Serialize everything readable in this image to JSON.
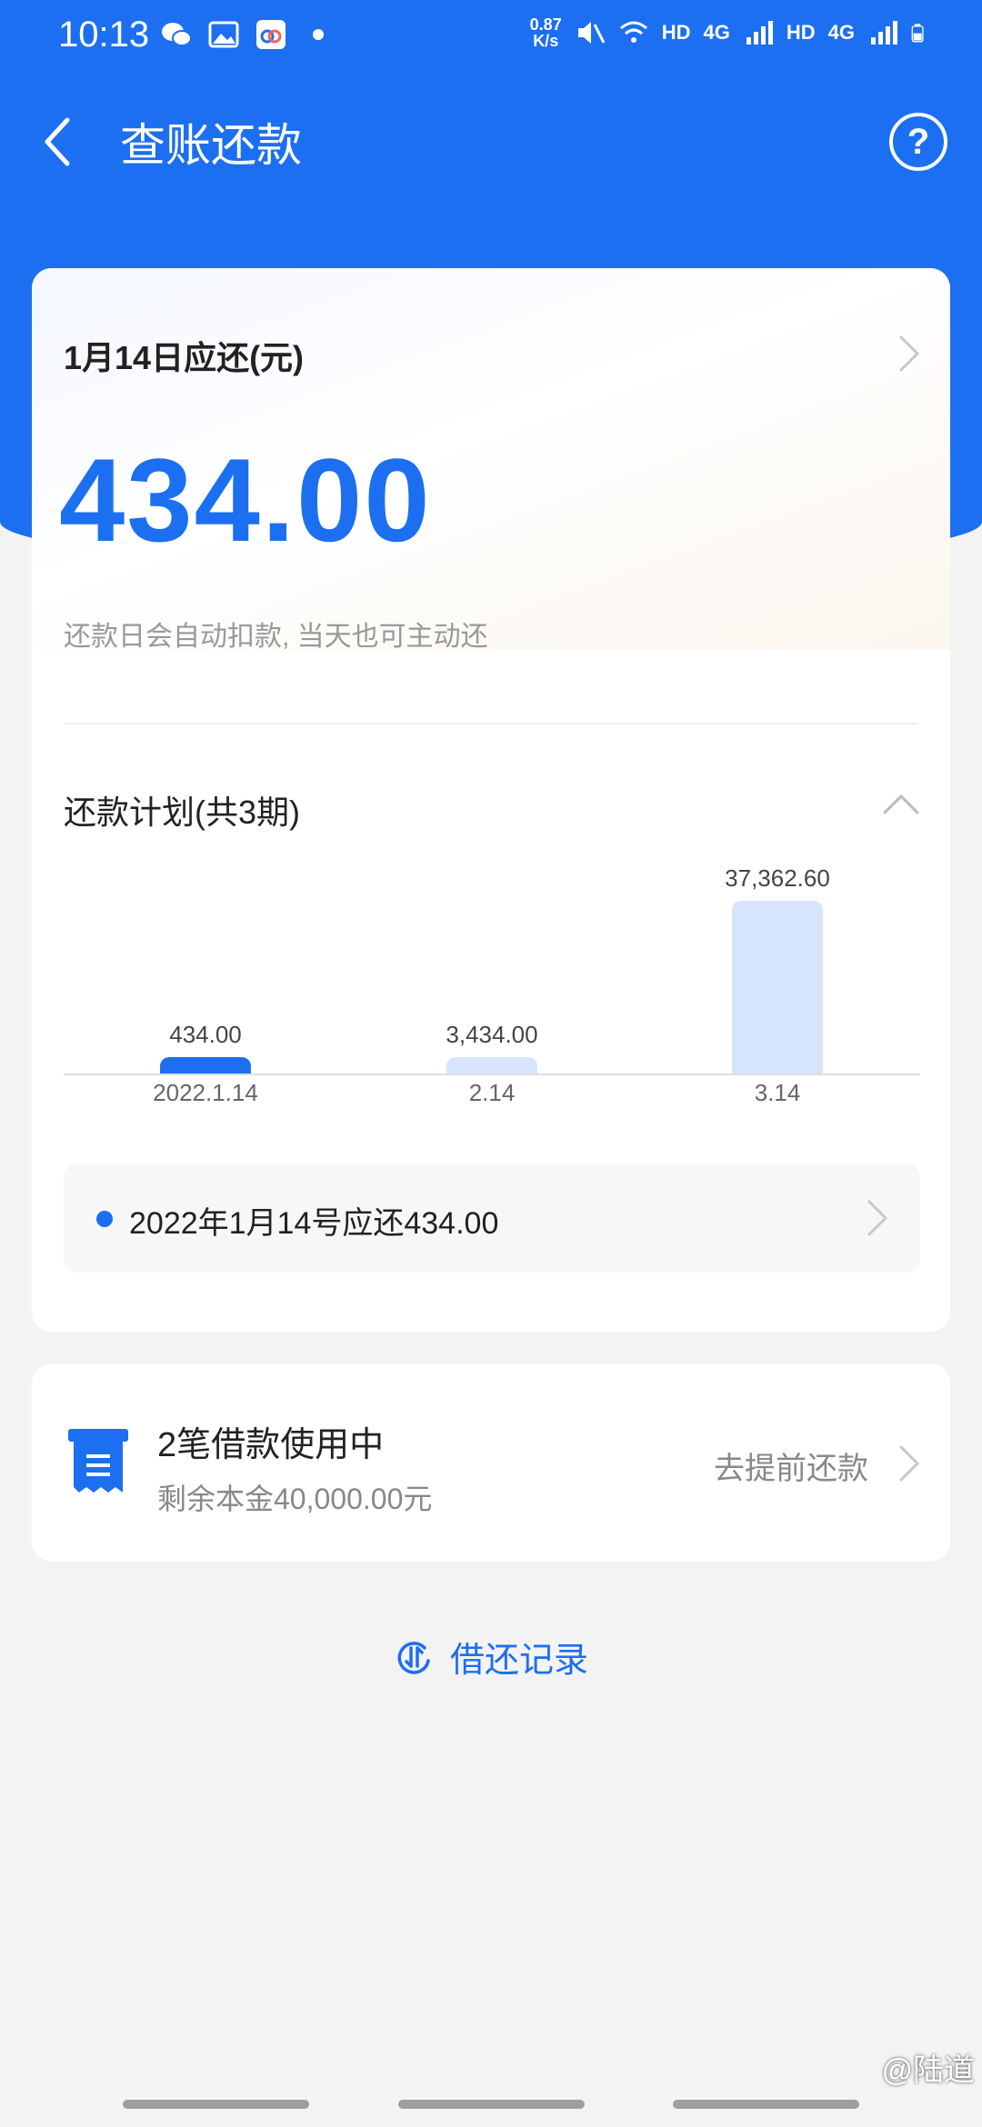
{
  "status_bar": {
    "time": "10:13",
    "net_speed_value": "0.87",
    "net_speed_unit": "K/s",
    "hd1": "HD",
    "hd2": "HD",
    "net1": "4G",
    "net2": "4G"
  },
  "nav": {
    "title": "查账还款",
    "help_label": "?"
  },
  "due": {
    "label": "1月14日应还(元)",
    "amount": "434.00",
    "note": "还款日会自动扣款, 当天也可主动还"
  },
  "plan": {
    "title": "还款计划(共3期)"
  },
  "chart_data": {
    "type": "bar",
    "categories": [
      "2022.1.14",
      "2.14",
      "3.14"
    ],
    "values": [
      434.0,
      3434.0,
      37362.6
    ],
    "value_labels": [
      "434.00",
      "3,434.00",
      "37,362.60"
    ],
    "highlight_index": 0,
    "colors": {
      "active": "#1c6ff0",
      "inactive": "#d6e5fc"
    }
  },
  "next_payment": {
    "text": "2022年1月14号应还434.00"
  },
  "loans": {
    "title": "2笔借款使用中",
    "subtitle": "剩余本金40,000.00元",
    "action": "去提前还款"
  },
  "records": {
    "label": "借还记录"
  },
  "watermark": "@陆道",
  "colors": {
    "primary": "#1c6ff0",
    "background": "#f3f3f3"
  }
}
